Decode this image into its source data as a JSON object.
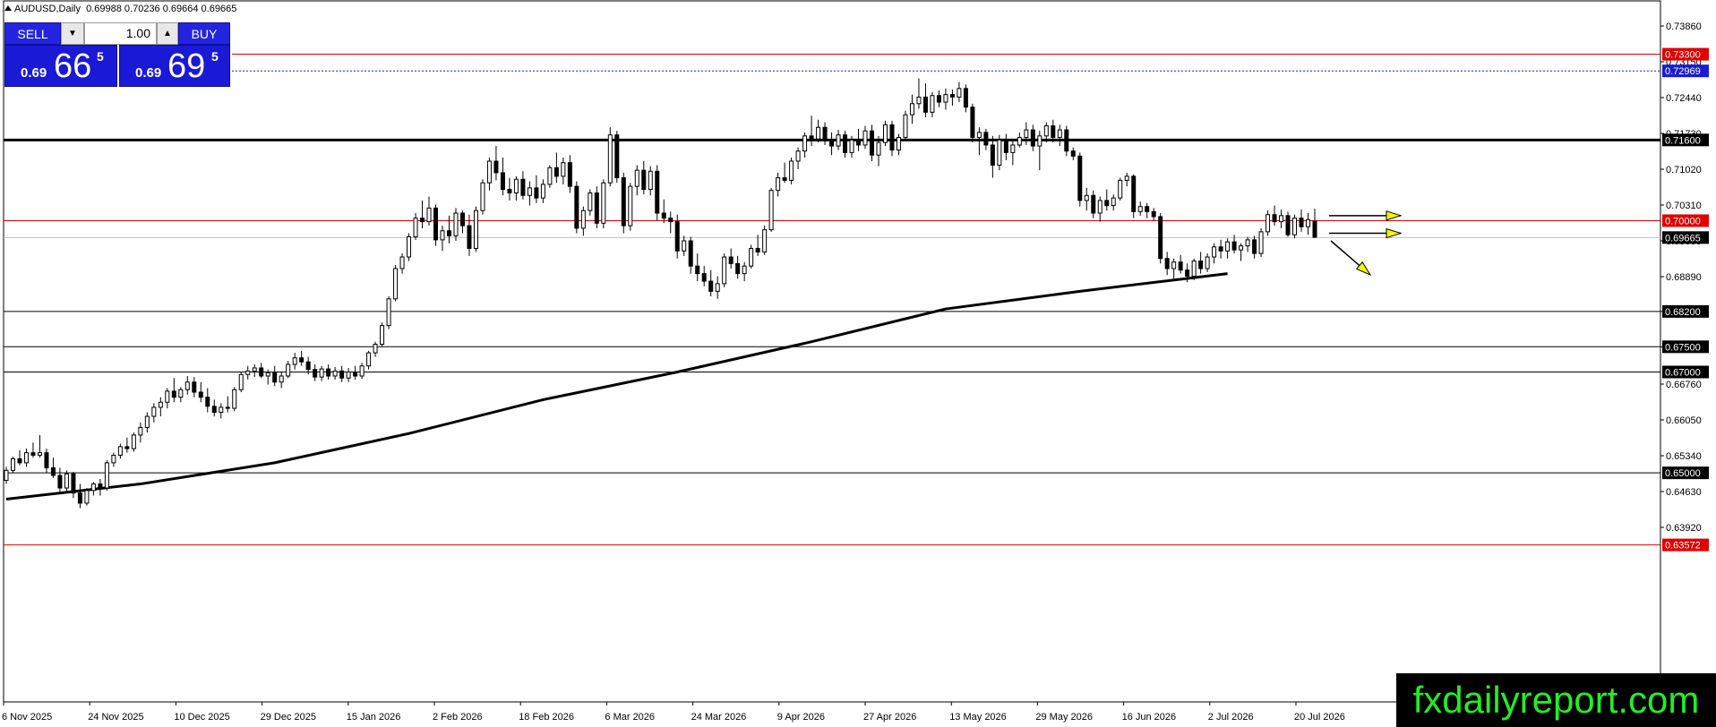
{
  "header": {
    "symbol": "AUDUSD,Daily",
    "ohlc": "0.69988 0.70236 0.69664 0.69665"
  },
  "trade_panel": {
    "sell_label": "SELL",
    "buy_label": "BUY",
    "lot_value": "1.00",
    "sell_price_prefix": "0.69",
    "sell_price_big": "66",
    "sell_price_sup": "5",
    "buy_price_prefix": "0.69",
    "buy_price_big": "69",
    "buy_price_sup": "5"
  },
  "watermark": "fxdailyreport.com",
  "colors": {
    "panel_blue": "#1a1ad6",
    "red_line": "#e00000",
    "blue_tag": "#1a1ad6",
    "arrow_yellow": "#f5f500",
    "watermark_green": "#22ee22"
  },
  "chart_data": {
    "type": "candlestick",
    "ylim": [
      0.63,
      0.7405
    ],
    "y_ticks": [
      "0.73860",
      "0.73150",
      "0.72440",
      "0.71730",
      "0.71020",
      "0.70310",
      "0.69600",
      "0.68890",
      "0.68200",
      "0.67500",
      "0.66760",
      "0.66050",
      "0.65340",
      "0.64630",
      "0.63920"
    ],
    "x_ticks": [
      "6 Nov 2025",
      "24 Nov 2025",
      "10 Dec 2025",
      "29 Dec 2025",
      "15 Jan 2026",
      "2 Feb 2026",
      "18 Feb 2026",
      "6 Mar 2026",
      "24 Mar 2026",
      "9 Apr 2026",
      "27 Apr 2026",
      "13 May 2026",
      "29 May 2026",
      "16 Jun 2026",
      "2 Jul 2026",
      "20 Jul 2026"
    ],
    "horizontal_levels": [
      {
        "price": 0.733,
        "label": "0.73300",
        "style": "red"
      },
      {
        "price": 0.72969,
        "label": "0.72969",
        "style": "blue-dotted"
      },
      {
        "price": 0.716,
        "label": "0.71600",
        "style": "black-thick"
      },
      {
        "price": 0.7,
        "label": "0.70000",
        "style": "red"
      },
      {
        "price": 0.69665,
        "label": "0.69665",
        "style": "current"
      },
      {
        "price": 0.682,
        "label": "0.68200",
        "style": "black"
      },
      {
        "price": 0.675,
        "label": "0.67500",
        "style": "black"
      },
      {
        "price": 0.67,
        "label": "0.67000",
        "style": "black"
      },
      {
        "price": 0.65,
        "label": "0.65000",
        "style": "black"
      },
      {
        "price": 0.63572,
        "label": "0.63572",
        "style": "red"
      }
    ],
    "candles": [
      [
        0.6485,
        0.6512,
        0.6478,
        0.6505
      ],
      [
        0.6505,
        0.6532,
        0.65,
        0.6528
      ],
      [
        0.6528,
        0.6545,
        0.6515,
        0.652
      ],
      [
        0.652,
        0.6548,
        0.6512,
        0.654
      ],
      [
        0.654,
        0.656,
        0.653,
        0.6535
      ],
      [
        0.6535,
        0.6575,
        0.653,
        0.654
      ],
      [
        0.654,
        0.6548,
        0.65,
        0.651
      ],
      [
        0.651,
        0.653,
        0.649,
        0.6495
      ],
      [
        0.6495,
        0.651,
        0.6462,
        0.647
      ],
      [
        0.647,
        0.6505,
        0.646,
        0.6498
      ],
      [
        0.6498,
        0.6502,
        0.645,
        0.646
      ],
      [
        0.646,
        0.6478,
        0.643,
        0.644
      ],
      [
        0.644,
        0.647,
        0.6435,
        0.6465
      ],
      [
        0.6465,
        0.6482,
        0.6455,
        0.6478
      ],
      [
        0.6478,
        0.6488,
        0.6455,
        0.647
      ],
      [
        0.647,
        0.6525,
        0.6465,
        0.652
      ],
      [
        0.652,
        0.654,
        0.6512,
        0.6535
      ],
      [
        0.6535,
        0.6558,
        0.6528,
        0.6552
      ],
      [
        0.6552,
        0.657,
        0.654,
        0.6548
      ],
      [
        0.6548,
        0.658,
        0.6542,
        0.6575
      ],
      [
        0.6575,
        0.66,
        0.656,
        0.659
      ],
      [
        0.659,
        0.662,
        0.658,
        0.6612
      ],
      [
        0.6612,
        0.6638,
        0.66,
        0.663
      ],
      [
        0.663,
        0.665,
        0.6612,
        0.664
      ],
      [
        0.664,
        0.6668,
        0.6628,
        0.6662
      ],
      [
        0.6662,
        0.6688,
        0.664,
        0.665
      ],
      [
        0.665,
        0.667,
        0.664,
        0.6665
      ],
      [
        0.6665,
        0.6692,
        0.6655,
        0.668
      ],
      [
        0.668,
        0.669,
        0.665,
        0.666
      ],
      [
        0.666,
        0.668,
        0.664,
        0.665
      ],
      [
        0.665,
        0.6668,
        0.662,
        0.6632
      ],
      [
        0.6632,
        0.6645,
        0.6612,
        0.662
      ],
      [
        0.662,
        0.6638,
        0.6608,
        0.663
      ],
      [
        0.663,
        0.6652,
        0.662,
        0.6628
      ],
      [
        0.6628,
        0.667,
        0.6622,
        0.6665
      ],
      [
        0.6665,
        0.67,
        0.666,
        0.6695
      ],
      [
        0.6695,
        0.6712,
        0.6685,
        0.6702
      ],
      [
        0.6702,
        0.6715,
        0.669,
        0.6708
      ],
      [
        0.6708,
        0.6718,
        0.6688,
        0.6692
      ],
      [
        0.6692,
        0.6705,
        0.6675,
        0.6698
      ],
      [
        0.6698,
        0.6712,
        0.6672,
        0.668
      ],
      [
        0.668,
        0.67,
        0.6668,
        0.6692
      ],
      [
        0.6692,
        0.6722,
        0.6688,
        0.6715
      ],
      [
        0.6715,
        0.6738,
        0.6705,
        0.6728
      ],
      [
        0.6728,
        0.6742,
        0.6712,
        0.672
      ],
      [
        0.672,
        0.673,
        0.6695,
        0.6705
      ],
      [
        0.6705,
        0.6715,
        0.6682,
        0.669
      ],
      [
        0.669,
        0.6712,
        0.6682,
        0.6706
      ],
      [
        0.6706,
        0.6715,
        0.6685,
        0.6692
      ],
      [
        0.6692,
        0.671,
        0.6685,
        0.6702
      ],
      [
        0.6702,
        0.6712,
        0.668,
        0.6688
      ],
      [
        0.6688,
        0.6708,
        0.668,
        0.67
      ],
      [
        0.67,
        0.6712,
        0.6685,
        0.6692
      ],
      [
        0.6692,
        0.6718,
        0.6686,
        0.6712
      ],
      [
        0.6712,
        0.6742,
        0.6705,
        0.6738
      ],
      [
        0.6738,
        0.676,
        0.673,
        0.6755
      ],
      [
        0.6755,
        0.6798,
        0.675,
        0.6792
      ],
      [
        0.6792,
        0.685,
        0.6785,
        0.6845
      ],
      [
        0.6845,
        0.6912,
        0.684,
        0.6905
      ],
      [
        0.6905,
        0.6935,
        0.6895,
        0.6928
      ],
      [
        0.6928,
        0.6975,
        0.692,
        0.6968
      ],
      [
        0.6968,
        0.7015,
        0.6962,
        0.7005
      ],
      [
        0.7005,
        0.704,
        0.6985,
        0.6998
      ],
      [
        0.6998,
        0.7048,
        0.699,
        0.7025
      ],
      [
        0.7025,
        0.7032,
        0.695,
        0.6962
      ],
      [
        0.6962,
        0.699,
        0.694,
        0.698
      ],
      [
        0.698,
        0.701,
        0.6955,
        0.697
      ],
      [
        0.697,
        0.7025,
        0.696,
        0.7015
      ],
      [
        0.7015,
        0.702,
        0.6975,
        0.699
      ],
      [
        0.699,
        0.7012,
        0.693,
        0.6945
      ],
      [
        0.6945,
        0.7028,
        0.6938,
        0.702
      ],
      [
        0.702,
        0.7082,
        0.7012,
        0.7075
      ],
      [
        0.7075,
        0.7125,
        0.706,
        0.7118
      ],
      [
        0.7118,
        0.7148,
        0.708,
        0.7095
      ],
      [
        0.7095,
        0.7125,
        0.705,
        0.7062
      ],
      [
        0.7062,
        0.7085,
        0.704,
        0.7055
      ],
      [
        0.7055,
        0.7088,
        0.704,
        0.7082
      ],
      [
        0.7082,
        0.7098,
        0.7042,
        0.705
      ],
      [
        0.705,
        0.7078,
        0.703,
        0.7065
      ],
      [
        0.7065,
        0.709,
        0.7035,
        0.7045
      ],
      [
        0.7045,
        0.7082,
        0.7035,
        0.7072
      ],
      [
        0.7072,
        0.711,
        0.7065,
        0.7105
      ],
      [
        0.7105,
        0.7135,
        0.7075,
        0.7088
      ],
      [
        0.7088,
        0.7125,
        0.7072,
        0.7115
      ],
      [
        0.7115,
        0.713,
        0.7055,
        0.7068
      ],
      [
        0.7068,
        0.7078,
        0.6975,
        0.6985
      ],
      [
        0.6985,
        0.7028,
        0.697,
        0.702
      ],
      [
        0.702,
        0.7062,
        0.701,
        0.7055
      ],
      [
        0.7055,
        0.7068,
        0.6985,
        0.6995
      ],
      [
        0.6995,
        0.7082,
        0.6985,
        0.7075
      ],
      [
        0.7075,
        0.7185,
        0.7068,
        0.717
      ],
      [
        0.717,
        0.7178,
        0.7075,
        0.7085
      ],
      [
        0.7085,
        0.7095,
        0.6975,
        0.699
      ],
      [
        0.699,
        0.7075,
        0.698,
        0.7068
      ],
      [
        0.7068,
        0.711,
        0.705,
        0.71
      ],
      [
        0.71,
        0.7118,
        0.7052,
        0.7062
      ],
      [
        0.7062,
        0.7108,
        0.705,
        0.7098
      ],
      [
        0.7098,
        0.711,
        0.7,
        0.7015
      ],
      [
        0.7015,
        0.7042,
        0.6995,
        0.7005
      ],
      [
        0.7005,
        0.7018,
        0.6975,
        0.6998
      ],
      [
        0.6998,
        0.7012,
        0.6925,
        0.694
      ],
      [
        0.694,
        0.697,
        0.693,
        0.696
      ],
      [
        0.696,
        0.6968,
        0.6895,
        0.691
      ],
      [
        0.691,
        0.6935,
        0.688,
        0.6895
      ],
      [
        0.6895,
        0.691,
        0.687,
        0.688
      ],
      [
        0.688,
        0.6902,
        0.685,
        0.686
      ],
      [
        0.686,
        0.689,
        0.6845,
        0.6875
      ],
      [
        0.6875,
        0.6935,
        0.6868,
        0.6928
      ],
      [
        0.6928,
        0.6945,
        0.6905,
        0.6915
      ],
      [
        0.6915,
        0.693,
        0.6885,
        0.6895
      ],
      [
        0.6895,
        0.6918,
        0.688,
        0.691
      ],
      [
        0.691,
        0.6952,
        0.6905,
        0.6945
      ],
      [
        0.6945,
        0.6972,
        0.693,
        0.6938
      ],
      [
        0.6938,
        0.699,
        0.6932,
        0.6982
      ],
      [
        0.6982,
        0.7065,
        0.6978,
        0.706
      ],
      [
        0.706,
        0.7095,
        0.7048,
        0.7085
      ],
      [
        0.7085,
        0.7115,
        0.7075,
        0.708
      ],
      [
        0.708,
        0.7125,
        0.7072,
        0.7118
      ],
      [
        0.7118,
        0.7145,
        0.7102,
        0.7138
      ],
      [
        0.7138,
        0.7175,
        0.7125,
        0.7168
      ],
      [
        0.7168,
        0.7208,
        0.7148,
        0.7162
      ],
      [
        0.7162,
        0.72,
        0.7155,
        0.7185
      ],
      [
        0.7185,
        0.7195,
        0.715,
        0.7158
      ],
      [
        0.7158,
        0.7175,
        0.713,
        0.7148
      ],
      [
        0.7148,
        0.718,
        0.714,
        0.717
      ],
      [
        0.717,
        0.7178,
        0.7125,
        0.7135
      ],
      [
        0.7135,
        0.7168,
        0.7125,
        0.716
      ],
      [
        0.716,
        0.7182,
        0.7138,
        0.715
      ],
      [
        0.715,
        0.7188,
        0.7142,
        0.7178
      ],
      [
        0.7178,
        0.719,
        0.7118,
        0.713
      ],
      [
        0.713,
        0.7168,
        0.7108,
        0.7155
      ],
      [
        0.7155,
        0.7198,
        0.7148,
        0.719
      ],
      [
        0.719,
        0.7198,
        0.7128,
        0.714
      ],
      [
        0.714,
        0.7172,
        0.713,
        0.7165
      ],
      [
        0.7165,
        0.7218,
        0.7158,
        0.721
      ],
      [
        0.721,
        0.725,
        0.7192,
        0.7232
      ],
      [
        0.7232,
        0.7282,
        0.7222,
        0.7245
      ],
      [
        0.7245,
        0.7272,
        0.7205,
        0.7215
      ],
      [
        0.7215,
        0.7255,
        0.7205,
        0.7248
      ],
      [
        0.7248,
        0.7258,
        0.7225,
        0.7235
      ],
      [
        0.7235,
        0.7262,
        0.722,
        0.725
      ],
      [
        0.725,
        0.726,
        0.7228,
        0.7245
      ],
      [
        0.7245,
        0.7275,
        0.7235,
        0.7262
      ],
      [
        0.7262,
        0.727,
        0.7215,
        0.7225
      ],
      [
        0.7225,
        0.7232,
        0.7155,
        0.7165
      ],
      [
        0.7165,
        0.7185,
        0.713,
        0.7175
      ],
      [
        0.7175,
        0.7182,
        0.714,
        0.715
      ],
      [
        0.715,
        0.7168,
        0.7085,
        0.711
      ],
      [
        0.711,
        0.717,
        0.71,
        0.716
      ],
      [
        0.716,
        0.7172,
        0.712,
        0.7135
      ],
      [
        0.7135,
        0.716,
        0.711,
        0.715
      ],
      [
        0.715,
        0.7175,
        0.7145,
        0.7165
      ],
      [
        0.7165,
        0.7195,
        0.715,
        0.718
      ],
      [
        0.718,
        0.719,
        0.7138,
        0.7148
      ],
      [
        0.7148,
        0.7178,
        0.71,
        0.7168
      ],
      [
        0.7168,
        0.7195,
        0.7155,
        0.7188
      ],
      [
        0.7188,
        0.72,
        0.7155,
        0.7165
      ],
      [
        0.7165,
        0.719,
        0.7148,
        0.718
      ],
      [
        0.718,
        0.7188,
        0.7128,
        0.7138
      ],
      [
        0.7138,
        0.7145,
        0.712,
        0.7128
      ],
      [
        0.7128,
        0.7135,
        0.7028,
        0.704
      ],
      [
        0.704,
        0.7065,
        0.702,
        0.705
      ],
      [
        0.705,
        0.706,
        0.7005,
        0.7015
      ],
      [
        0.7015,
        0.7048,
        0.6998,
        0.704
      ],
      [
        0.704,
        0.7062,
        0.702,
        0.703
      ],
      [
        0.703,
        0.7052,
        0.702,
        0.7045
      ],
      [
        0.7045,
        0.7085,
        0.704,
        0.708
      ],
      [
        0.708,
        0.7095,
        0.7068,
        0.7088
      ],
      [
        0.7088,
        0.7092,
        0.7005,
        0.7018
      ],
      [
        0.7018,
        0.7038,
        0.701,
        0.7028
      ],
      [
        0.7028,
        0.7035,
        0.7005,
        0.7018
      ],
      [
        0.7018,
        0.7025,
        0.7,
        0.7008
      ],
      [
        0.7008,
        0.7015,
        0.6915,
        0.6925
      ],
      [
        0.6925,
        0.6938,
        0.6892,
        0.6905
      ],
      [
        0.6905,
        0.6925,
        0.6885,
        0.6918
      ],
      [
        0.6918,
        0.6932,
        0.6895,
        0.6902
      ],
      [
        0.6902,
        0.6915,
        0.6878,
        0.689
      ],
      [
        0.689,
        0.6925,
        0.6882,
        0.692
      ],
      [
        0.692,
        0.6938,
        0.6895,
        0.6905
      ],
      [
        0.6905,
        0.6935,
        0.6898,
        0.6928
      ],
      [
        0.6928,
        0.6955,
        0.6915,
        0.6948
      ],
      [
        0.6948,
        0.6962,
        0.6925,
        0.694
      ],
      [
        0.694,
        0.6965,
        0.6925,
        0.6958
      ],
      [
        0.6958,
        0.6972,
        0.6935,
        0.6942
      ],
      [
        0.6942,
        0.6955,
        0.692,
        0.695
      ],
      [
        0.695,
        0.6968,
        0.6938,
        0.6962
      ],
      [
        0.6962,
        0.697,
        0.6925,
        0.6935
      ],
      [
        0.6935,
        0.6985,
        0.6928,
        0.6978
      ],
      [
        0.6978,
        0.702,
        0.697,
        0.7012
      ],
      [
        0.7012,
        0.703,
        0.699,
        0.6998
      ],
      [
        0.6998,
        0.7022,
        0.6985,
        0.701
      ],
      [
        0.701,
        0.7018,
        0.6968,
        0.6972
      ],
      [
        0.6972,
        0.7012,
        0.6965,
        0.7005
      ],
      [
        0.7005,
        0.7022,
        0.6978,
        0.6988
      ],
      [
        0.6988,
        0.7015,
        0.6972,
        0.7002
      ],
      [
        0.6999,
        0.7024,
        0.6966,
        0.6967
      ]
    ],
    "moving_average": {
      "name": "",
      "points": [
        [
          0,
          0.6448
        ],
        [
          20,
          0.6478
        ],
        [
          40,
          0.652
        ],
        [
          60,
          0.6578
        ],
        [
          80,
          0.6645
        ],
        [
          100,
          0.67
        ],
        [
          120,
          0.676
        ],
        [
          140,
          0.6825
        ],
        [
          160,
          0.686
        ],
        [
          182,
          0.6895
        ]
      ]
    },
    "annotations": [
      {
        "type": "arrow",
        "direction": "right",
        "price": 0.701
      },
      {
        "type": "arrow",
        "direction": "right",
        "price": 0.6975
      },
      {
        "type": "arrow",
        "direction": "down-right",
        "price": 0.696
      }
    ]
  }
}
